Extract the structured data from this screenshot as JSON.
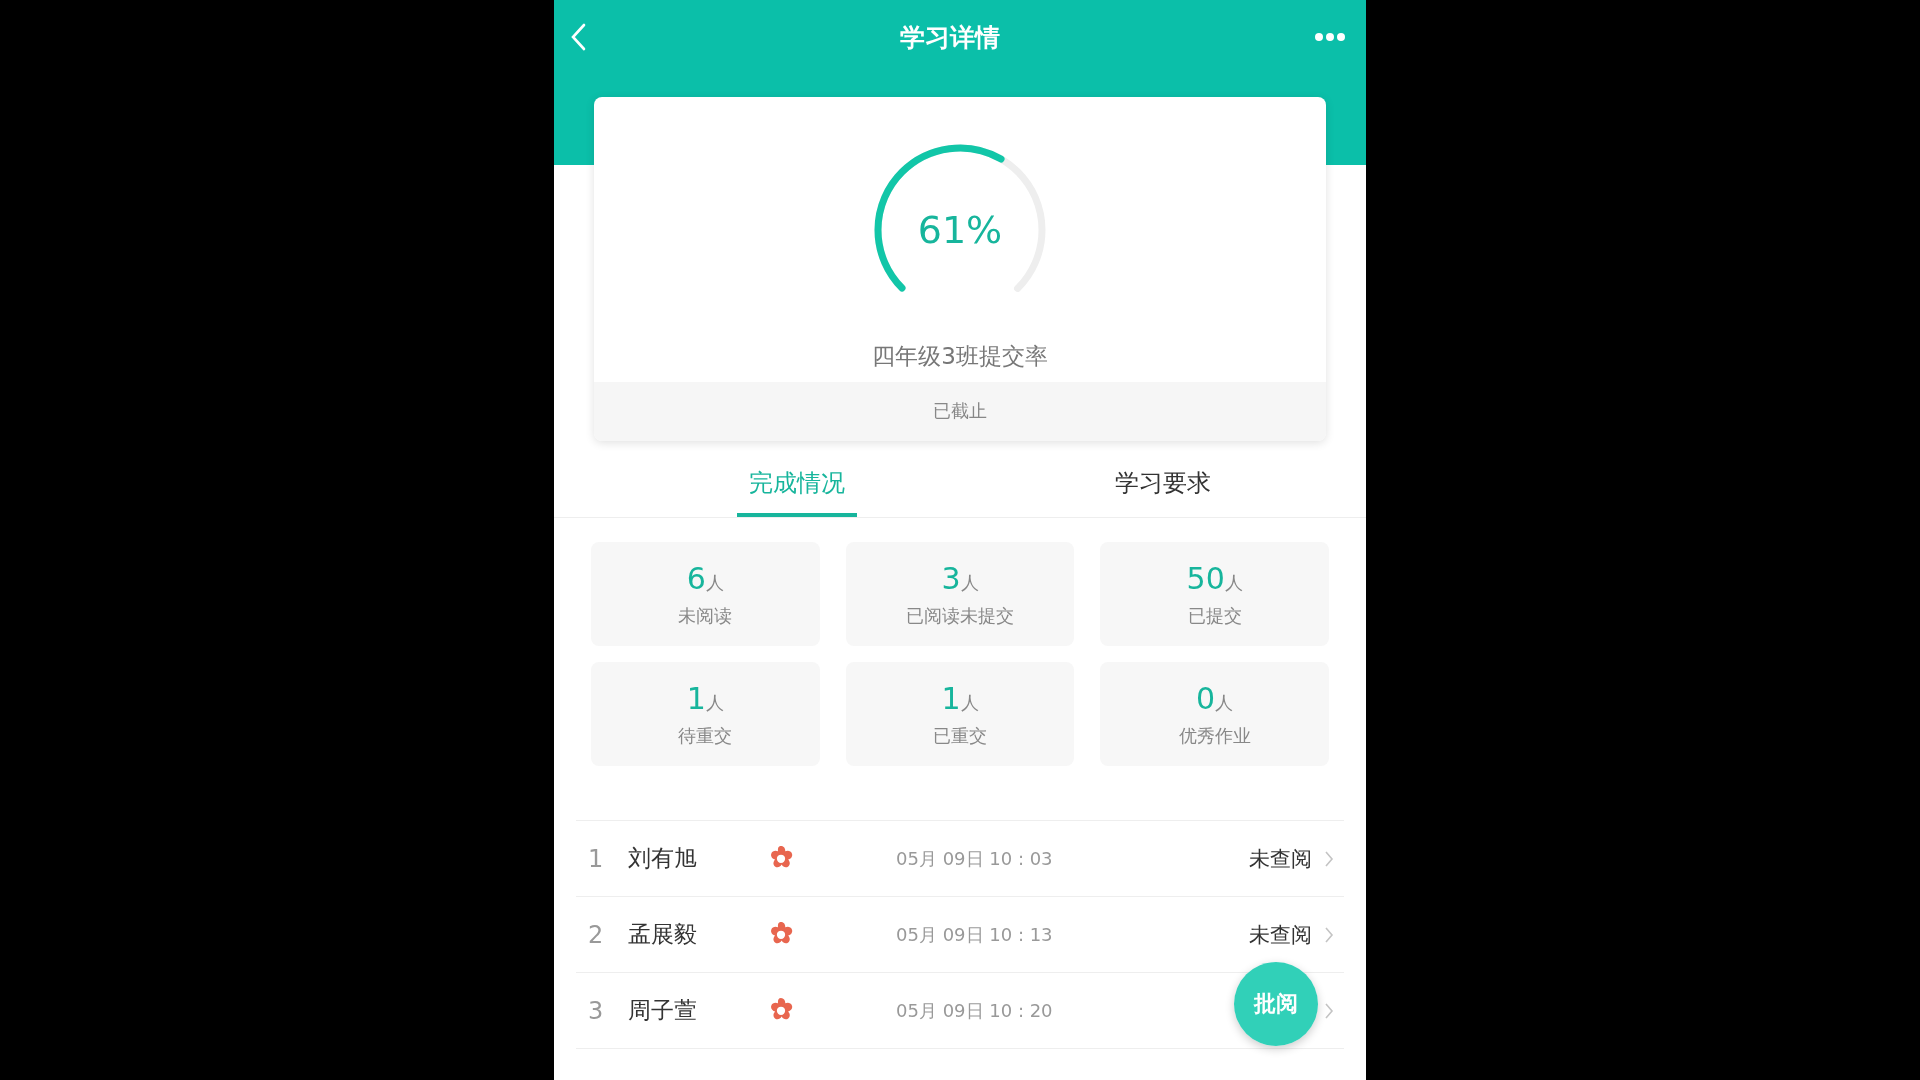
{
  "header": {
    "title": "学习详情"
  },
  "progress": {
    "text": "61%",
    "level": 0.61,
    "caption": "四年级3班提交率",
    "status": "已截止"
  },
  "tabs": [
    {
      "label": "完成情况",
      "selected": true
    },
    {
      "label": "学习要求",
      "selected": false
    }
  ],
  "stats": [
    {
      "count": "6",
      "unit": "人",
      "label": "未阅读"
    },
    {
      "count": "3",
      "unit": "人",
      "label": "已阅读未提交"
    },
    {
      "count": "50",
      "unit": "人",
      "label": "已提交"
    },
    {
      "count": "1",
      "unit": "人",
      "label": "待重交"
    },
    {
      "count": "1",
      "unit": "人",
      "label": "已重交"
    },
    {
      "count": "0",
      "unit": "人",
      "label": "优秀作业"
    }
  ],
  "students": [
    {
      "index": "1",
      "name": "刘有旭",
      "time": "05月 09日 10 : 03",
      "status": "未查阅"
    },
    {
      "index": "2",
      "name": "孟展毅",
      "time": "05月 09日 10 : 13",
      "status": "未查阅"
    },
    {
      "index": "3",
      "name": "周子萱",
      "time": "05月 09日 10 : 20"
    }
  ],
  "fab": {
    "label": "批阅"
  }
}
